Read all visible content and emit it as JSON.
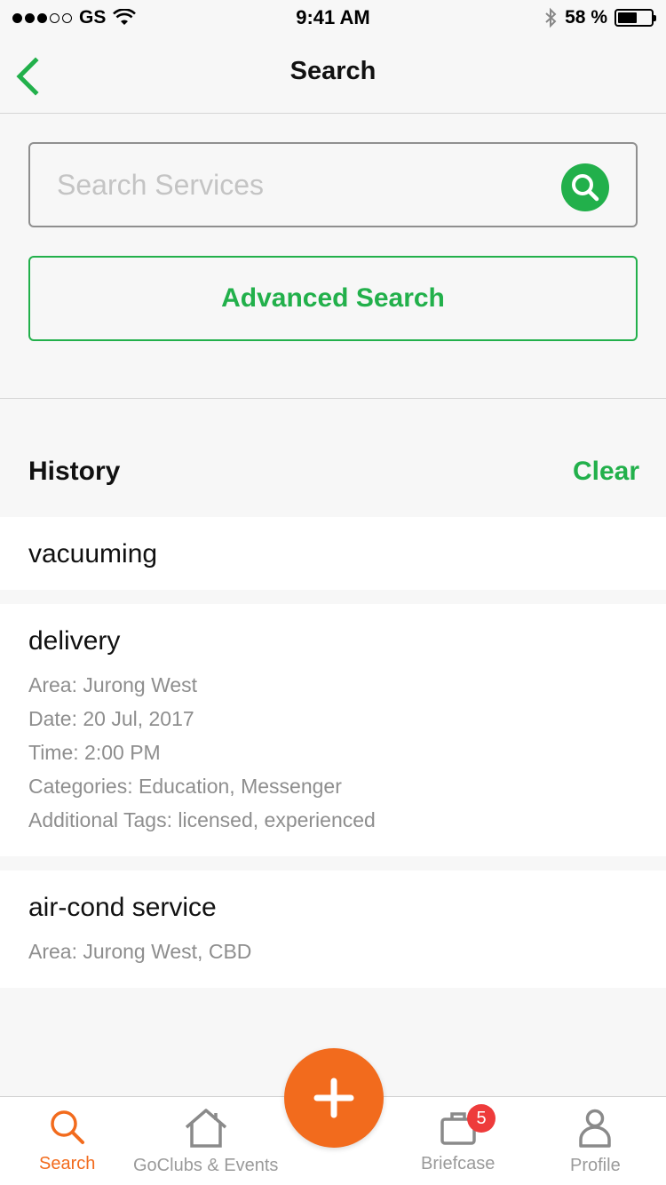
{
  "status_bar": {
    "carrier": "GS",
    "time": "9:41 AM",
    "battery": "58 %",
    "battery_level": 0.58
  },
  "nav": {
    "title": "Search"
  },
  "search": {
    "placeholder": "Search Services",
    "value": ""
  },
  "advanced_search": {
    "label": "Advanced Search"
  },
  "history": {
    "title": "History",
    "clear_label": "Clear",
    "items": [
      {
        "title": "vacuuming",
        "details": []
      },
      {
        "title": "delivery",
        "details": [
          "Area: Jurong West",
          "Date: 20 Jul, 2017",
          "Time: 2:00 PM",
          "Categories: Education, Messenger",
          "Additional Tags: licensed, experienced"
        ]
      },
      {
        "title": "air-cond service",
        "details": [
          "Area: Jurong West, CBD"
        ]
      }
    ]
  },
  "tab_bar": {
    "search": "Search",
    "goclubs": "GoClubs & Events",
    "briefcase": "Briefcase",
    "briefcase_badge": "5",
    "profile": "Profile"
  },
  "colors": {
    "accent_green": "#22b04b",
    "accent_orange": "#f26b1d",
    "badge_red": "#ee3b3b"
  }
}
